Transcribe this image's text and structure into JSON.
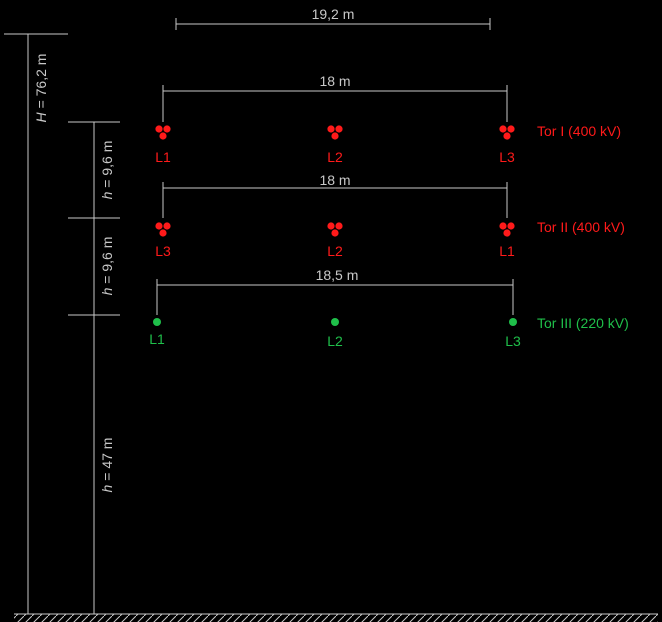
{
  "colors": {
    "background": "#000000",
    "dimension": "#c8c8c8",
    "system400": "#ff1a1a",
    "system220": "#1fbf4a"
  },
  "top_span": "19,2 m",
  "total_height": {
    "symbol": "H",
    "value": " = 76,2 m"
  },
  "height_dims": [
    {
      "symbol": "h",
      "value": " = 9,6 m"
    },
    {
      "symbol": "h",
      "value": " = 9,6 m"
    },
    {
      "symbol": "h",
      "value": " = 47 m"
    }
  ],
  "systems": [
    {
      "span": "18 m",
      "label": "Tor I (400 kV)",
      "phases": [
        "L1",
        "L2",
        "L3"
      ],
      "bundle": "triple"
    },
    {
      "span": "18 m",
      "label": "Tor II (400 kV)",
      "phases": [
        "L3",
        "L2",
        "L1"
      ],
      "bundle": "triple"
    },
    {
      "span": "18,5 m",
      "label": "Tor III (220 kV)",
      "phases": [
        "L1",
        "L2",
        "L3"
      ],
      "bundle": "single"
    }
  ]
}
